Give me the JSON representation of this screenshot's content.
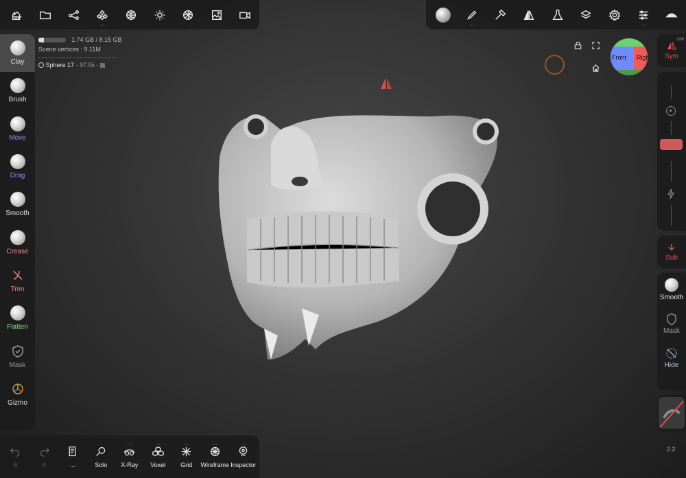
{
  "top_toolbar_left": [
    {
      "name": "scene-icon"
    },
    {
      "name": "folder-icon"
    },
    {
      "name": "share-icon"
    },
    {
      "name": "scene-tree-icon",
      "dots": "..."
    },
    {
      "name": "topology-icon"
    },
    {
      "name": "light-icon"
    },
    {
      "name": "material-icon"
    },
    {
      "name": "background-image-icon"
    },
    {
      "name": "camera-icon"
    }
  ],
  "top_toolbar_right": [
    {
      "name": "brush-sphere-icon"
    },
    {
      "name": "stroke-icon",
      "dots": "..."
    },
    {
      "name": "hammer-icon"
    },
    {
      "name": "symmetry-icon"
    },
    {
      "name": "flask-icon"
    },
    {
      "name": "layers-icon"
    },
    {
      "name": "settings-gear-icon"
    },
    {
      "name": "sliders-icon",
      "dots": "..."
    },
    {
      "name": "hide-ui-icon"
    }
  ],
  "info": {
    "memory": "1.74 GB / 8.15 GB",
    "memory_fraction": 0.21,
    "vertices_label": "Scene vertices :",
    "vertices_value": "9.11M",
    "object_name": "Sphere 17",
    "object_detail": "- 97.5k -"
  },
  "left_tools": [
    {
      "name": "clay",
      "label": "Clay",
      "color": "#e0e0e0",
      "active": true,
      "icon": "ball"
    },
    {
      "name": "brush",
      "label": "Brush",
      "color": "#e0e0e0",
      "icon": "ball"
    },
    {
      "name": "move",
      "label": "Move",
      "color": "#9b8cff",
      "icon": "ball"
    },
    {
      "name": "drag",
      "label": "Drag",
      "color": "#9b8cff",
      "icon": "ball"
    },
    {
      "name": "smooth",
      "label": "Smooth",
      "color": "#e0e0e0",
      "icon": "ball"
    },
    {
      "name": "crease",
      "label": "Crease",
      "color": "#f08a8a",
      "icon": "ball"
    },
    {
      "name": "trim",
      "label": "Trim",
      "color": "#f08a8a",
      "icon": "trim"
    },
    {
      "name": "flatten",
      "label": "Flatten",
      "color": "#8ae08a",
      "icon": "ball"
    },
    {
      "name": "mask",
      "label": "Mask",
      "color": "#9a9a9a",
      "icon": "mask"
    },
    {
      "name": "gizmo",
      "label": "Gizmo",
      "color": "#e0e0e0",
      "icon": "gizmo"
    }
  ],
  "right_panel": {
    "sym_label": "Sym",
    "sym_badge": "L/W",
    "sub_label": "Sub",
    "smooth_label": "Smooth",
    "mask_label": "Mask",
    "hide_label": "Hide",
    "accent_red": "#e05050",
    "slider_color": "#d05a5a"
  },
  "gizmo_cube": {
    "front": "Front",
    "right": "Right"
  },
  "bottom_bar": [
    {
      "name": "undo",
      "label": "6",
      "dim": true
    },
    {
      "name": "redo",
      "label": "0",
      "dim": true
    },
    {
      "name": "history",
      "label": "..."
    },
    {
      "name": "solo",
      "label": "Solo"
    },
    {
      "name": "xray",
      "label": "X-Ray"
    },
    {
      "name": "voxel",
      "label": "Voxel"
    },
    {
      "name": "grid",
      "label": "Grid"
    },
    {
      "name": "wireframe",
      "label": "Wireframe"
    },
    {
      "name": "inspector",
      "label": "Inspector"
    }
  ],
  "version": "2.2"
}
